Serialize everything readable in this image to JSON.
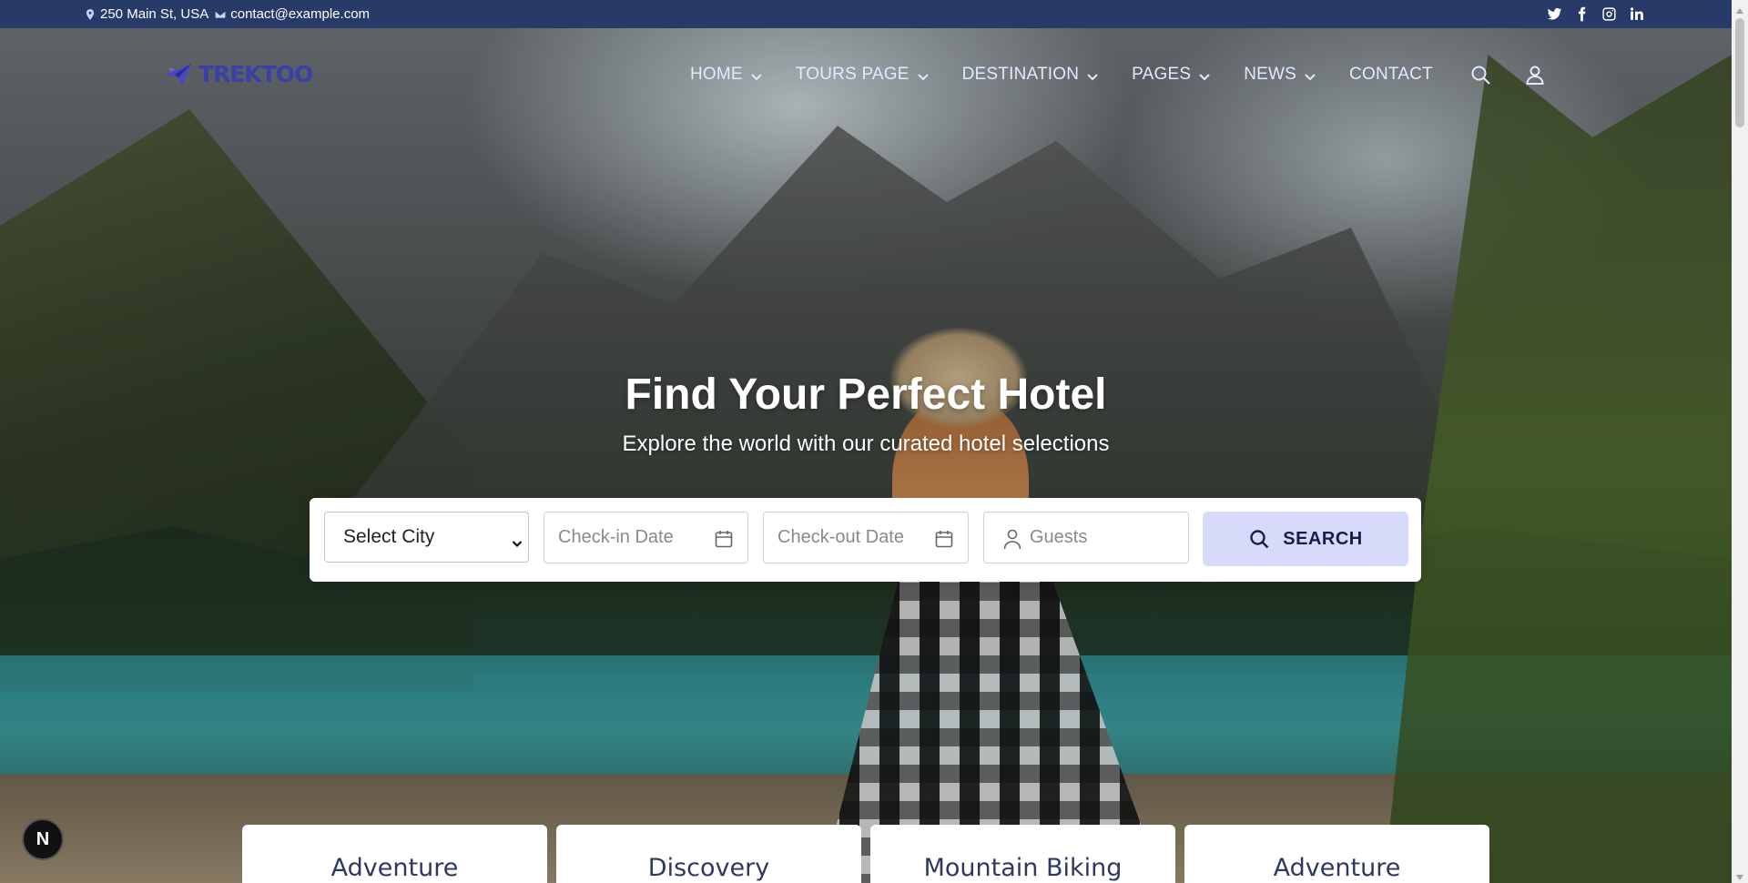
{
  "topbar": {
    "address": "250 Main St, USA",
    "email": "contact@example.com",
    "socials": [
      "twitter-icon",
      "facebook-icon",
      "instagram-icon",
      "linkedin-icon"
    ]
  },
  "nav": {
    "logo_text": "TREKTOO",
    "items": [
      {
        "label": "HOME",
        "dropdown": true
      },
      {
        "label": "TOURS PAGE",
        "dropdown": true
      },
      {
        "label": "DESTINATION",
        "dropdown": true
      },
      {
        "label": "PAGES",
        "dropdown": true
      },
      {
        "label": "NEWS",
        "dropdown": true
      },
      {
        "label": "CONTACT",
        "dropdown": false
      }
    ]
  },
  "hero": {
    "title": "Find Your Perfect Hotel",
    "subtitle": "Explore the world with our curated hotel selections"
  },
  "search": {
    "city_value": "Select City",
    "checkin_placeholder": "Check-in Date",
    "checkout_placeholder": "Check-out Date",
    "guests_placeholder": "Guests",
    "button_label": "SEARCH"
  },
  "cards": [
    {
      "title": "Adventure"
    },
    {
      "title": "Discovery"
    },
    {
      "title": "Mountain Biking"
    },
    {
      "title": "Adventure"
    }
  ],
  "badge": {
    "letter": "N"
  },
  "colors": {
    "topbar_bg": "#273a68",
    "logo": "#3b3fa8",
    "search_button_bg": "#d8dafa",
    "card_text": "#2b3a60"
  }
}
